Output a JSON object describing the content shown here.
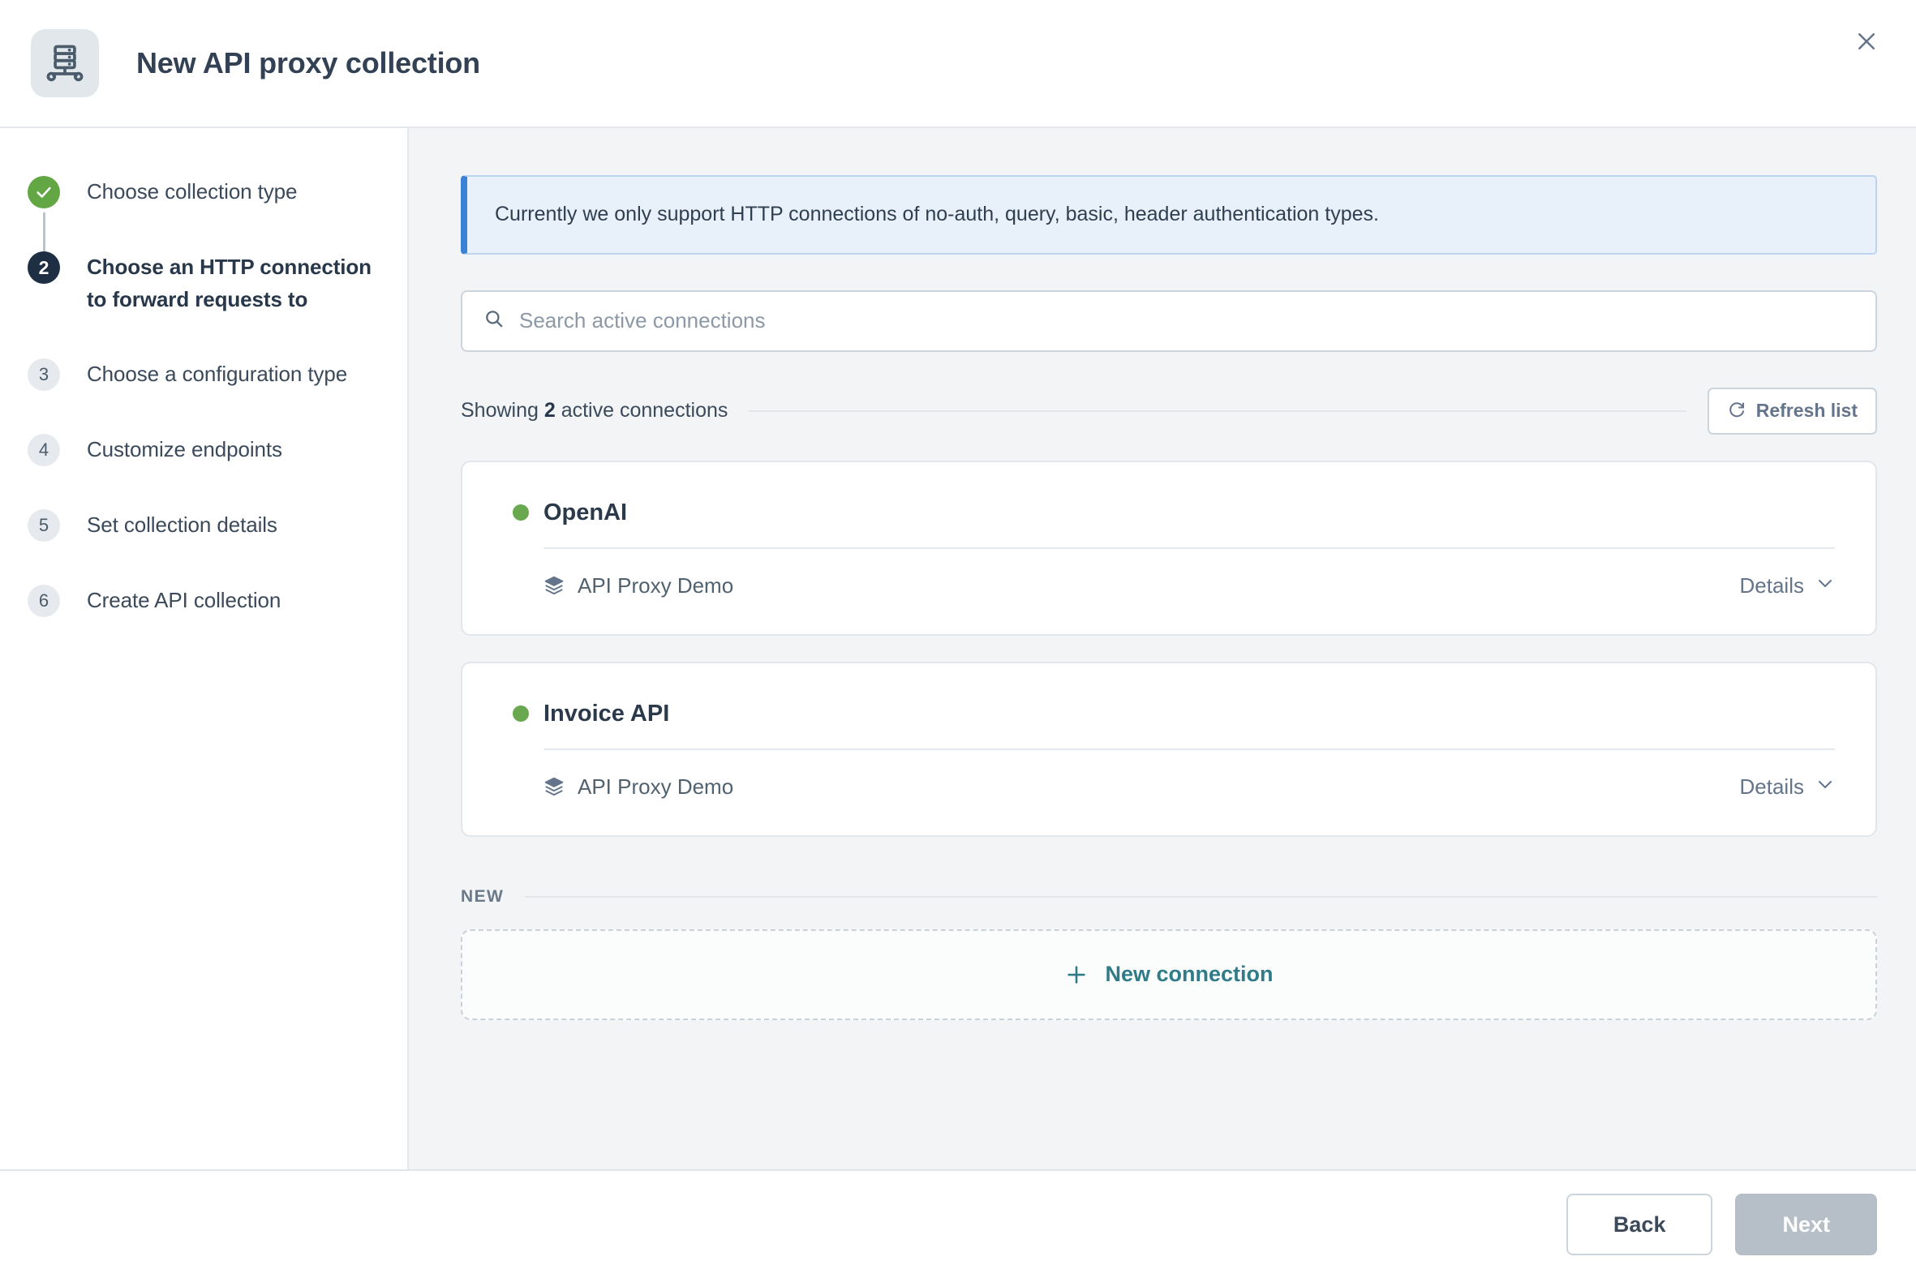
{
  "header": {
    "title": "New API proxy collection",
    "app_icon": "server-rack-icon",
    "close_icon": "close-icon"
  },
  "sidebar": {
    "steps": [
      {
        "number": "1",
        "label": "Choose collection type",
        "state": "done"
      },
      {
        "number": "2",
        "label": "Choose an HTTP connection to forward requests to",
        "state": "current"
      },
      {
        "number": "3",
        "label": "Choose a configuration type",
        "state": "todo"
      },
      {
        "number": "4",
        "label": "Customize endpoints",
        "state": "todo"
      },
      {
        "number": "5",
        "label": "Set collection details",
        "state": "todo"
      },
      {
        "number": "6",
        "label": "Create API collection",
        "state": "todo"
      }
    ]
  },
  "main": {
    "banner": {
      "text": "Currently we only support HTTP connections of no-auth, query, basic, header authentication types.",
      "accent_color": "#3b82d6",
      "background_color": "#e8f0fa"
    },
    "search": {
      "placeholder": "Search active connections",
      "value": "",
      "icon": "search-icon"
    },
    "count_row": {
      "prefix": "Showing ",
      "count": "2",
      "suffix": " active connections",
      "refresh_label": "Refresh list",
      "refresh_icon": "refresh-icon"
    },
    "connections": [
      {
        "name": "OpenAI",
        "status_color": "#6aa84f",
        "item_label": "API Proxy Demo",
        "item_icon": "layers-icon",
        "details_label": "Details",
        "details_icon": "chevron-down-icon"
      },
      {
        "name": "Invoice API",
        "status_color": "#6aa84f",
        "item_label": "API Proxy Demo",
        "item_icon": "layers-icon",
        "details_label": "Details",
        "details_icon": "chevron-down-icon"
      }
    ],
    "new_section": {
      "label": "NEW",
      "button_label": "New connection",
      "button_icon": "plus-icon",
      "accent_color": "#2f7c88"
    }
  },
  "footer": {
    "back_label": "Back",
    "next_label": "Next"
  }
}
